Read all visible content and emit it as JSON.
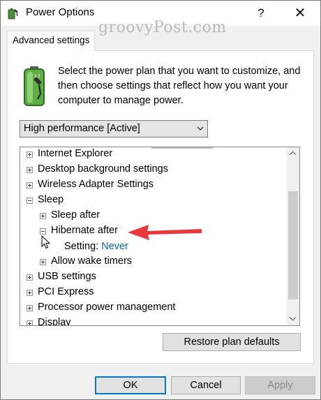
{
  "window": {
    "title": "Power Options",
    "help_glyph": "?",
    "close_glyph": "✕"
  },
  "watermark": "groovyPost.com",
  "tab": {
    "label": "Advanced settings"
  },
  "description": "Select the power plan that you want to customize, and then choose settings that reflect how you want your computer to manage power.",
  "plan_select": {
    "value": "High performance [Active]"
  },
  "tree": {
    "items": [
      {
        "label": "Internet Explorer",
        "state": "collapsed"
      },
      {
        "label": "Desktop background settings",
        "state": "collapsed"
      },
      {
        "label": "Wireless Adapter Settings",
        "state": "collapsed"
      },
      {
        "label": "Sleep",
        "state": "expanded"
      },
      {
        "label": "Sleep after",
        "state": "collapsed"
      },
      {
        "label": "Hibernate after",
        "state": "expanded"
      },
      {
        "label": "Allow wake timers",
        "state": "collapsed"
      },
      {
        "label": "USB settings",
        "state": "collapsed"
      },
      {
        "label": "PCI Express",
        "state": "collapsed"
      },
      {
        "label": "Processor power management",
        "state": "collapsed"
      },
      {
        "label": "Display",
        "state": "collapsed"
      }
    ],
    "setting": {
      "label": "Setting:",
      "value": "Never"
    }
  },
  "buttons": {
    "restore": "Restore plan defaults",
    "ok": "OK",
    "cancel": "Cancel",
    "apply": "Apply"
  },
  "colors": {
    "link": "#0067c0",
    "annotation_arrow": "#e8383d",
    "default_button_border": "#0078d7"
  }
}
